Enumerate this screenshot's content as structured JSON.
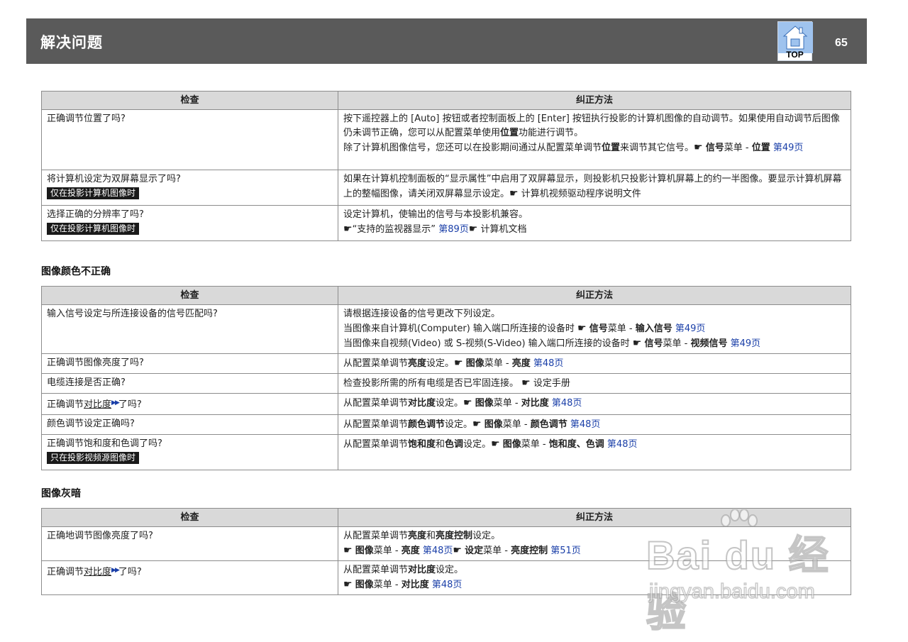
{
  "header": {
    "title": "解决问题",
    "page_number": "65",
    "top_label": "TOP"
  },
  "table1": {
    "col_check": "检查",
    "col_fix": "纠正方法",
    "rows": [
      {
        "check": "正确调节位置了吗?",
        "fix1_a": "按下遥控器上的 [Auto] 按钮或者控制面板上的 [Enter] 按钮执行投影的计算机图像的自动调节。如果使用自动调节后图像仍未调节正确，您可以从配置菜单使用",
        "fix1_b": "位置",
        "fix1_c": "功能进行调节。",
        "fix2_a": "除了计算机图像信号，您还可以在投影期间通过从配置菜单调节",
        "fix2_b": "位置",
        "fix2_c": "来调节其它信号。",
        "fix2_d": "信号",
        "fix2_e": "菜单 - ",
        "fix2_f": "位置",
        "fix2_link": "第49页"
      },
      {
        "check": "将计算机设定为双屏幕显示了吗?",
        "tag": "仅在投影计算机图像时",
        "fix": "如果在计算机控制面板的“显示属性”中启用了双屏幕显示，则投影机只投影计算机屏幕上的约一半图像。要显示计算机屏幕上的整幅图像，请关闭双屏幕显示设定。",
        "fix_ref": "计算机视频驱动程序说明文件"
      },
      {
        "check": "选择正确的分辨率了吗?",
        "tag": "仅在投影计算机图像时",
        "fix1": "设定计算机，使输出的信号与本投影机兼容。",
        "fix2_a": "“支持的监视器显示”",
        "fix2_link": "第89页",
        "fix2_b": "计算机文档"
      }
    ]
  },
  "section2": {
    "title": "图像颜色不正确"
  },
  "table2": {
    "col_check": "检查",
    "col_fix": "纠正方法",
    "rows": [
      {
        "check": "输入信号设定与所连接设备的信号匹配吗?",
        "fix1": "请根据连接设备的信号更改下列设定。",
        "fix2_a": "当图像来自计算机(Computer) 输入端口所连接的设备时",
        "fix2_b": "信号",
        "fix2_c": "菜单 - ",
        "fix2_d": "输入信号",
        "fix2_link": "第49页",
        "fix3_a": "当图像来自视频(Video) 或 S-视频(S-Video) 输入端口所连接的设备时",
        "fix3_b": "信号",
        "fix3_c": "菜单 - ",
        "fix3_d": "视频信号",
        "fix3_link": "第49页"
      },
      {
        "check": "正确调节图像亮度了吗?",
        "fix_a": "从配置菜单调节",
        "fix_b": "亮度",
        "fix_c": "设定。",
        "fix_d": "图像",
        "fix_e": "菜单 - ",
        "fix_f": "亮度",
        "fix_link": "第48页"
      },
      {
        "check": "电缆连接是否正确?",
        "fix": "检查投影所需的所有电缆是否已牢固连接。",
        "fix_ref": "设定手册"
      },
      {
        "check_a": "正确调节",
        "check_b": "对比度",
        "check_c": "了吗?",
        "fix_a": "从配置菜单调节",
        "fix_b": "对比度",
        "fix_c": "设定。",
        "fix_d": "图像",
        "fix_e": "菜单 - ",
        "fix_f": "对比度",
        "fix_link": "第48页"
      },
      {
        "check": "颜色调节设定正确吗?",
        "fix_a": "从配置菜单调节",
        "fix_b": "颜色调节",
        "fix_c": "设定。",
        "fix_d": "图像",
        "fix_e": "菜单 - ",
        "fix_f": "颜色调节",
        "fix_link": "第48页"
      },
      {
        "check": "正确调节饱和度和色调了吗?",
        "tag": "只在投影视频源图像时",
        "fix_a": "从配置菜单调节",
        "fix_b": "饱和度",
        "fix_c": "和",
        "fix_d": "色调",
        "fix_e": "设定。",
        "fix_f": "图像",
        "fix_g": "菜单 - ",
        "fix_h": "饱和度、色调",
        "fix_link": "第48页"
      }
    ]
  },
  "section3": {
    "title": "图像灰暗"
  },
  "table3": {
    "col_check": "检查",
    "col_fix": "纠正方法",
    "rows": [
      {
        "check": "正确地调节图像亮度了吗?",
        "fix1_a": "从配置菜单调节",
        "fix1_b": "亮度",
        "fix1_c": "和",
        "fix1_d": "亮度控制",
        "fix1_e": "设定。",
        "fix2_a": "图像",
        "fix2_b": "菜单 - ",
        "fix2_c": "亮度",
        "fix2_link1": "第48页",
        "fix2_d": "设定",
        "fix2_e": "菜单 - ",
        "fix2_f": "亮度控制",
        "fix2_link2": "第51页"
      },
      {
        "check_a": "正确调节",
        "check_b": "对比度",
        "check_c": "了吗?",
        "fix1_a": "从配置菜单调节",
        "fix1_b": "对比度",
        "fix1_c": "设定。",
        "fix2_a": "图像",
        "fix2_b": "菜单 - ",
        "fix2_c": "对比度",
        "fix2_link": "第48页"
      }
    ]
  },
  "icons": {
    "pointer": "pointing-hand-icon",
    "glossary": "glossary-arrow-icon",
    "top": "home-top-icon"
  },
  "watermark": {
    "logo": "Bai du 经验",
    "url": "jingyan.baidu.com"
  }
}
